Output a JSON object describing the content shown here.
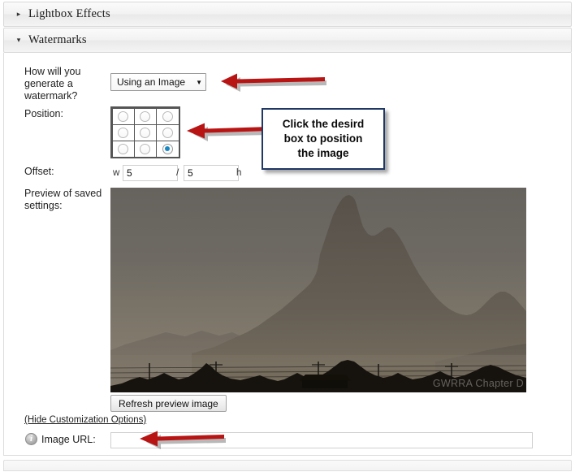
{
  "sections": [
    {
      "title": "Lightbox Effects",
      "expanded": false,
      "triangle": "collapsed-triangle-icon",
      "glyph": "▸"
    },
    {
      "title": "Watermarks",
      "expanded": true,
      "triangle": "expanded-triangle-icon",
      "glyph": "▾"
    }
  ],
  "form": {
    "generate_label": "How will you generate a watermark?",
    "watermark_type": {
      "selected": "Using an Image",
      "arrow_glyph": "▼",
      "options": [
        "Using an Image"
      ]
    },
    "position_label": "Position:",
    "position_grid": {
      "rows": 3,
      "cols": 3,
      "selected_index": 8,
      "selected_name": "bottom-right"
    },
    "offset_label": "Offset:",
    "offset": {
      "width_prefix": "w",
      "width_value": "5",
      "separator": "/",
      "height_value": "5",
      "height_suffix": "h"
    },
    "preview_label": "Preview of saved settings:",
    "refresh_button": "Refresh preview image",
    "hide_options_link": "(Hide Customization Options)",
    "image_url_label": "Image URL:",
    "image_url_value": "",
    "image_url_placeholder": "",
    "info_icon_glyph": "i"
  },
  "preview": {
    "watermark_text": "GWRRA Chapter D",
    "description": "hazy desert landscape with mountain peak silhouette",
    "sky_top_color": "#6b6862",
    "sky_horizon_color": "#7e766a",
    "mountain_color": "#5d5850",
    "foreground_color": "#15130f"
  },
  "annotations": {
    "arrow_color": "#bb1111",
    "callout_border_color": "#1f3864",
    "callout_text": "Click the desird box to position the image",
    "callout_lines": [
      "Click the desird",
      "box to position",
      "the image"
    ],
    "arrows": [
      {
        "name": "arrow-to-watermark-type",
        "direction": "left"
      },
      {
        "name": "arrow-to-position-grid",
        "direction": "left"
      },
      {
        "name": "arrow-to-image-url",
        "direction": "left"
      }
    ]
  }
}
